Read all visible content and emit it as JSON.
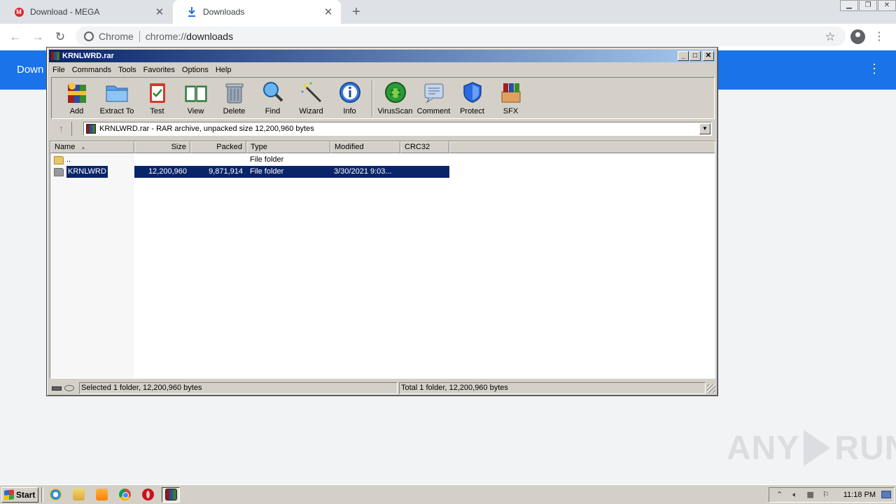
{
  "chrome": {
    "tabs": [
      {
        "label": "Download - MEGA",
        "icon": "mega-logo-icon",
        "active": false
      },
      {
        "label": "Downloads",
        "icon": "download-icon",
        "active": true
      }
    ],
    "omnibox": {
      "chip": "Chrome",
      "url_scheme": "chrome://",
      "url_path": "downloads"
    },
    "page_title_partial": "Down",
    "accent_color": "#1a73e8"
  },
  "winrar": {
    "title": "KRNLWRD.rar",
    "menu": [
      "File",
      "Commands",
      "Tools",
      "Favorites",
      "Options",
      "Help"
    ],
    "toolbar": [
      {
        "label": "Add",
        "icon": "add-archive-icon"
      },
      {
        "label": "Extract To",
        "icon": "extract-folder-icon"
      },
      {
        "label": "Test",
        "icon": "test-clipboard-icon"
      },
      {
        "label": "View",
        "icon": "view-book-icon"
      },
      {
        "label": "Delete",
        "icon": "trash-icon"
      },
      {
        "label": "Find",
        "icon": "magnifier-icon"
      },
      {
        "label": "Wizard",
        "icon": "magic-wand-icon"
      },
      {
        "label": "Info",
        "icon": "info-icon"
      },
      {
        "label": "VirusScan",
        "icon": "virus-scan-icon"
      },
      {
        "label": "Comment",
        "icon": "comment-icon"
      },
      {
        "label": "Protect",
        "icon": "shield-icon"
      },
      {
        "label": "SFX",
        "icon": "sfx-box-icon"
      }
    ],
    "address": "KRNLWRD.rar - RAR archive, unpacked size 12,200,960 bytes",
    "columns": {
      "name": "Name",
      "size": "Size",
      "packed": "Packed",
      "type": "Type",
      "modified": "Modified",
      "crc": "CRC32"
    },
    "rows": [
      {
        "name": "..",
        "size": "",
        "packed": "",
        "type": "File folder",
        "modified": "",
        "crc": "",
        "selected": false
      },
      {
        "name": "KRNLWRD",
        "size": "12,200,960",
        "packed": "9,871,914",
        "type": "File folder",
        "modified": "3/30/2021 9:03...",
        "crc": "",
        "selected": true
      }
    ],
    "status_left": "Selected 1 folder, 12,200,960 bytes",
    "status_right": "Total 1 folder, 12,200,960 bytes"
  },
  "watermark": {
    "left": "ANY",
    "right": "RUN"
  },
  "taskbar": {
    "start": "Start",
    "clock": "11:18 PM"
  }
}
